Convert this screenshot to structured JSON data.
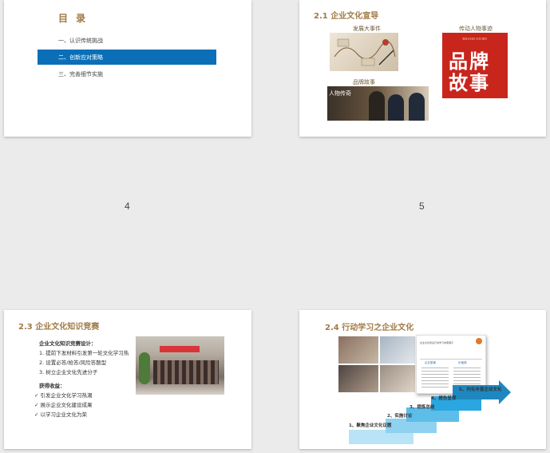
{
  "slide4": {
    "page_number": "4",
    "toc_title": "目 录",
    "items": [
      {
        "label": "一、认识传统挑战",
        "active": false
      },
      {
        "label": "二、创新应对策略",
        "active": true
      },
      {
        "label": "三、完善细节实施",
        "active": false
      }
    ],
    "accent": "#0b6fb8"
  },
  "slide5": {
    "page_number": "5",
    "title": "2.1 企业文化宣导",
    "captions": {
      "events": "发展大事件",
      "people": "传动人物事迹",
      "brand": "品牌故事"
    },
    "brand_image_text": "品牌故事",
    "brand_image_sub": "BRAND STORY",
    "people_image_text": "人物传奇"
  },
  "slide6": {
    "title": "2.3 企业文化知识竞赛",
    "design_heading": "企业文化知识竞赛设计：",
    "design_items": [
      "1.  提前下发材料引发第一轮文化学习热",
      "2.  设置必答/抢答/风险答题型",
      "3.  树立企业文化先进分子"
    ],
    "gain_heading": "获得收益：",
    "gain_items": [
      "✓  引发企业文化学习热潮",
      "✓  展示企业文化建设成果",
      "✓  以学习企业文化为荣"
    ]
  },
  "slide7": {
    "title": "2.4 行动学习之企业文化",
    "steps": [
      "1、聚焦企业文化议题",
      "2、实施讨论",
      "3、提炼总结",
      "4、报告呈现",
      "5、内化丰富企业文化"
    ],
    "card_header": "企业文化建设行动学习成果展示",
    "card_left_label": "企业愿景",
    "card_right_label": "价值观",
    "accent": "#1ea7e1"
  }
}
